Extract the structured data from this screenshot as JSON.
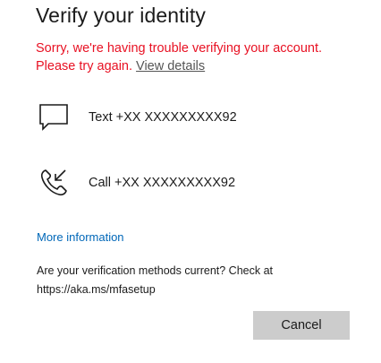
{
  "dialog": {
    "title": "Verify your identity",
    "error_message": "Sorry, we're having trouble verifying your account. Please try again.",
    "error_link": "View details",
    "methods": [
      {
        "icon": "message-icon",
        "label": "Text +XX XXXXXXXXX92"
      },
      {
        "icon": "phone-call-icon",
        "label": "Call +XX XXXXXXXXX92"
      }
    ],
    "more_info_link": "More information",
    "notice": "Are your verification methods current? Check at https://aka.ms/mfasetup",
    "cancel_label": "Cancel"
  },
  "colors": {
    "error": "#e81123",
    "link": "#0067b8",
    "button_bg": "#cccccc",
    "text": "#1b1b1b"
  }
}
